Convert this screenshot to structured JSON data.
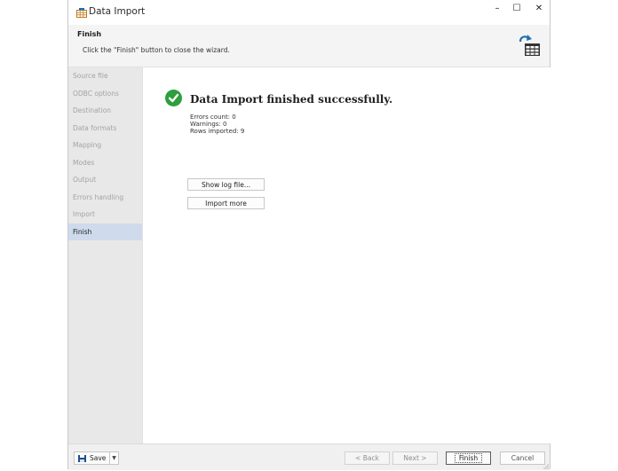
{
  "window": {
    "title": "Data Import"
  },
  "title_controls": {
    "minimize": "–",
    "maximize": "☐",
    "close": "✕"
  },
  "header": {
    "title": "Finish",
    "description": "Click the \"Finish\" button to close the wizard."
  },
  "sidebar": {
    "items": [
      {
        "label": "Source file",
        "active": false
      },
      {
        "label": "ODBC options",
        "active": false
      },
      {
        "label": "Destination",
        "active": false
      },
      {
        "label": "Data formats",
        "active": false
      },
      {
        "label": "Mapping",
        "active": false
      },
      {
        "label": "Modes",
        "active": false
      },
      {
        "label": "Output",
        "active": false
      },
      {
        "label": "Errors handling",
        "active": false
      },
      {
        "label": "Import",
        "active": false
      },
      {
        "label": "Finish",
        "active": true
      }
    ]
  },
  "main": {
    "status_title": "Data Import finished successfully.",
    "stats": [
      "Errors count: 0",
      "Warnings: 0",
      "Rows imported: 9"
    ],
    "show_log_label": "Show log file...",
    "import_more_label": "Import more"
  },
  "footer": {
    "save_label": "Save",
    "back_label": "< Back",
    "next_label": "Next >",
    "finish_label": "Finish",
    "cancel_label": "Cancel"
  },
  "colors": {
    "success": "#2e9e3e",
    "active_nav": "#cfdbed",
    "sidebar_bg": "#e8e8e8",
    "accent_blue": "#1f6fb5"
  },
  "icons": {
    "title": "table-icon",
    "header": "import-arrow-table-icon",
    "success": "check-circle-icon",
    "save": "floppy-disk-icon",
    "dropdown": "caret-down-icon"
  }
}
